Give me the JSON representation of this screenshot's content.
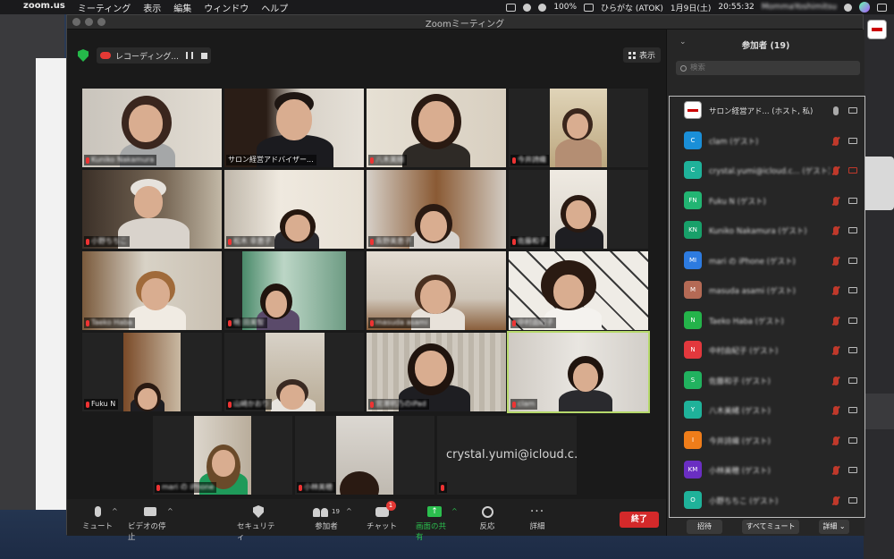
{
  "menubar": {
    "app": "zoom.us",
    "items": [
      "ミーティング",
      "表示",
      "編集",
      "ウィンドウ",
      "ヘルプ"
    ],
    "battery": "100%",
    "ime": "ひらがな (ATOK)",
    "date": "1月9日(土)",
    "time": "20:55:32",
    "user": "MommaYoshimitsu"
  },
  "window": {
    "title": "Zoomミーティング"
  },
  "recording": {
    "label": "レコーディング..."
  },
  "view_button": {
    "label": "表示"
  },
  "tiles": [
    {
      "name": "Kuniko Nakamura"
    },
    {
      "name": "サロン経営アドバイザー..."
    },
    {
      "name": "八木美緒"
    },
    {
      "name": "今井詩織"
    },
    {
      "name": "小野ちちこ"
    },
    {
      "name": "松木 幸恵子"
    },
    {
      "name": "長野美恵子"
    },
    {
      "name": "佐藤和子"
    },
    {
      "name": "Taeko Haba"
    },
    {
      "name": "暁 田美智"
    },
    {
      "name": "masuda asami"
    },
    {
      "name": "中村由紀子"
    },
    {
      "name": "Fuku N"
    },
    {
      "name": "山崎かおり"
    },
    {
      "name": "宮澤明乃のiPad"
    },
    {
      "name": "clam"
    },
    {
      "name": "mari の iPhone"
    },
    {
      "name": "小林美穂"
    },
    {
      "name": "crystal.yumi@icloud.c..."
    }
  ],
  "toolbar": {
    "mute": "ミュート",
    "video": "ビデオの停止",
    "security": "セキュリティ",
    "participants": "参加者",
    "participants_count": "19",
    "chat": "チャット",
    "chat_badge": "1",
    "share": "画面の共有",
    "react": "反応",
    "more": "詳細",
    "end": "終了"
  },
  "panel": {
    "title": "参加者 (19)",
    "search_placeholder": "検索",
    "participants": [
      {
        "name": "サロン経営アド... (ホスト, 私)",
        "initials": "",
        "color": "#ffffff"
      },
      {
        "name": "clam (ゲスト)",
        "initials": "C",
        "color": "#1a8fd8"
      },
      {
        "name": "crystal.yumi@icloud.c... (ゲスト)",
        "initials": "C",
        "color": "#1fb29a"
      },
      {
        "name": "Fuku N (ゲスト)",
        "initials": "FN",
        "color": "#22b573"
      },
      {
        "name": "Kuniko Nakamura (ゲスト)",
        "initials": "KN",
        "color": "#18a06a"
      },
      {
        "name": "mari の iPhone (ゲスト)",
        "initials": "MI",
        "color": "#2d7be0"
      },
      {
        "name": "masuda asami (ゲスト)",
        "initials": "M",
        "color": "#b46a55"
      },
      {
        "name": "Taeko Haba (ゲスト)",
        "initials": "N",
        "color": "#24b34a"
      },
      {
        "name": "中村由紀子 (ゲスト)",
        "initials": "N",
        "color": "#e2383d"
      },
      {
        "name": "佐藤和子 (ゲスト)",
        "initials": "S",
        "color": "#21b25f"
      },
      {
        "name": "八木美緒 (ゲスト)",
        "initials": "Y",
        "color": "#1fb29a"
      },
      {
        "name": "今井詩織 (ゲスト)",
        "initials": "I",
        "color": "#ef7d1a"
      },
      {
        "name": "小林美穂 (ゲスト)",
        "initials": "KM",
        "color": "#6a2ec2"
      },
      {
        "name": "小野ちちこ (ゲスト)",
        "initials": "O",
        "color": "#1fb29a"
      }
    ],
    "invite": "招待",
    "mute_all": "すべてミュート",
    "more": "詳細"
  }
}
